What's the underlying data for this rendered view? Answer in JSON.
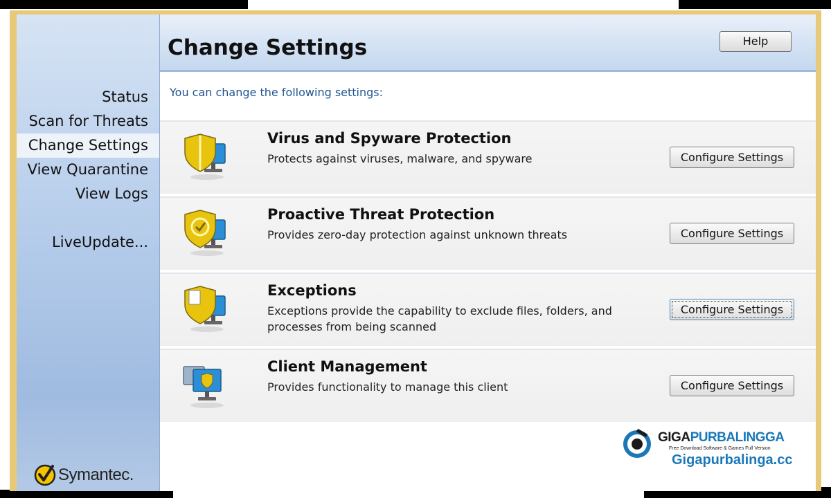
{
  "header": {
    "title": "Change Settings",
    "help_label": "Help"
  },
  "sidebar": {
    "items": [
      {
        "label": "Status"
      },
      {
        "label": "Scan for Threats"
      },
      {
        "label": "Change Settings",
        "selected": true
      },
      {
        "label": "View Quarantine"
      },
      {
        "label": "View Logs"
      }
    ],
    "liveupdate_label": "LiveUpdate...",
    "brand": "Symantec."
  },
  "main": {
    "intro": "You can change the following settings:",
    "panels": [
      {
        "title": "Virus and Spyware Protection",
        "description": "Protects against viruses, malware, and spyware",
        "button": "Configure Settings",
        "icon": "shield-monitor-icon"
      },
      {
        "title": "Proactive Threat Protection",
        "description": "Provides zero-day protection against unknown threats",
        "button": "Configure Settings",
        "icon": "proactive-shield-icon"
      },
      {
        "title": "Exceptions",
        "description": "Exceptions provide the capability to exclude files, folders, and processes from being scanned",
        "button": "Configure Settings",
        "icon": "exceptions-shield-icon"
      },
      {
        "title": "Client Management",
        "description": "Provides functionality to manage this client",
        "button": "Configure Settings",
        "icon": "client-monitor-icon"
      }
    ]
  },
  "watermark": {
    "brand_part1": "GIGA",
    "brand_part2": "PURBALINGGA",
    "tagline": "Free Download Software & Games Full Version",
    "url": "Gigapurbalinga.cc"
  },
  "colors": {
    "accent": "#1f5590",
    "frame": "#e8c97a",
    "sidebar": "#afc8e8",
    "shield": "#e8c40f",
    "monitor": "#2a8fd6"
  }
}
